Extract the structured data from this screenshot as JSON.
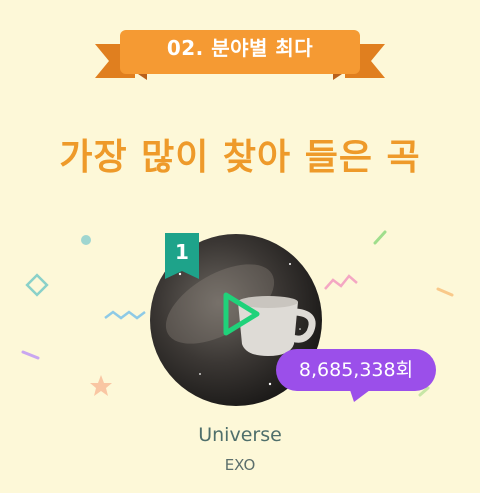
{
  "section": {
    "label": "02. 분야별 최다"
  },
  "headline": "가장 많이 찾아 들은 곡",
  "song": {
    "rank": "1",
    "title": "Universe",
    "artist": "EXO",
    "play_count": "8,685,338회"
  },
  "colors": {
    "background": "#fdf8d8",
    "ribbon": "#f59a33",
    "headline": "#ee9a2a",
    "rank_badge": "#1ea38a",
    "play_icon": "#1fd27a",
    "bubble": "#9b4fea"
  },
  "icons": {
    "play": "play-icon"
  }
}
